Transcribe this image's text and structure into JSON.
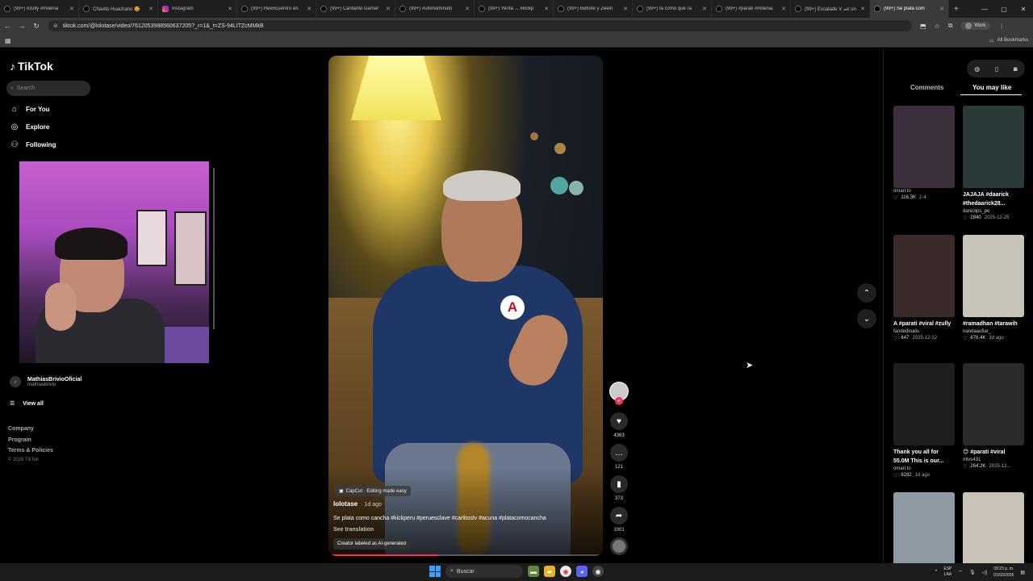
{
  "browser": {
    "tabs": [
      {
        "title": "(99+) #zully #milenia"
      },
      {
        "title": "Chavito Huachano 🤩"
      },
      {
        "title": "Instagram",
        "icon": "instagram-icon"
      },
      {
        "title": "(99+) Reencuentro en"
      },
      {
        "title": "(99+) Cantante Gamer"
      },
      {
        "title": "(99+) #ultimominuto"
      },
      {
        "title": "(99+) Yerita ... #kickp"
      },
      {
        "title": "(99+) Bebote y Zeein"
      },
      {
        "title": "(99+) tá como que ra"
      },
      {
        "title": "(99+) #parati #milenia"
      },
      {
        "title": "(99+) Escalade V 🏎 un"
      },
      {
        "title": "(99+) Se plata com",
        "active": true
      }
    ],
    "new_tab": "+",
    "url": "tiktok.com/@lolotase/video/7612053988560637205?_r=1&_t=ZS-94LITZcMMkB",
    "profile_label": "Work",
    "bookmarks_label": "All Bookmarks"
  },
  "sidebar": {
    "logo": "TikTok",
    "search_placeholder": "Search",
    "nav": [
      {
        "label": "For You",
        "icon": "home-icon"
      },
      {
        "label": "Explore",
        "icon": "compass-icon"
      },
      {
        "label": "Following",
        "icon": "following-icon"
      }
    ],
    "account": {
      "name": "MathiasBrivioOficial",
      "handle": "mathiasbrivio"
    },
    "view_all": "View all",
    "footer": [
      "Company",
      "Program",
      "Terms & Policies"
    ],
    "copyright": "© 2026 TikTok"
  },
  "video": {
    "capcut_label": "CapCut · Editing made easy",
    "author": "lolotase",
    "age": "· 1d ago",
    "caption": "Se plata como cancha #kickperu #peruesclave #carlitostv #acuna #platacomocancha",
    "see_translation": "See translation",
    "ai_label": "Creator labeled as AI-generated",
    "badge_letter": "A",
    "actions": {
      "likes": "4363",
      "comments": "121",
      "saves": "373",
      "shares": "1001"
    },
    "progress": 0.4
  },
  "right_panel": {
    "tabs": [
      "Comments",
      "You may like"
    ],
    "active_tab": "You may like",
    "cards": [
      {
        "title": "",
        "user": "omari.to",
        "likes": "116.3K",
        "date": "2-4",
        "color": "#3a2f3a"
      },
      {
        "title": "JAJAJA #daarick #thedaarick28...",
        "user": "daniclips_pe",
        "likes": "2840",
        "date": "2025-12-25",
        "color": "#2a3a38"
      },
      {
        "title": "A #parati #viral #zully",
        "user": "fandedioalis",
        "likes": "647",
        "date": "2025-12-12",
        "color": "#3b2a2a"
      },
      {
        "title": "#ramadhan #tarawih",
        "user": "nandaaufiar_",
        "likes": "876.4K",
        "date": "3d ago",
        "color": "#c8c4b8"
      },
      {
        "title": "Thank you all for 55.0M This is our...",
        "user": "omari.to",
        "likes": "8282",
        "date": "1d ago",
        "color": "#1e1e1e"
      },
      {
        "title": "😊 #parati #viral",
        "user": "mlvs431",
        "likes": "264.2K",
        "date": "2025-12...",
        "color": "#2a2a2a"
      },
      {
        "title": "",
        "user": "",
        "likes": "",
        "date": "",
        "color": "#8e99a4"
      },
      {
        "title": "",
        "user": "",
        "likes": "",
        "date": "",
        "color": "#c9c2b8"
      }
    ]
  },
  "taskbar": {
    "search_placeholder": "Buscar",
    "lang_top": "ESP",
    "lang_bottom": "LAA",
    "time": "09:23 p. m.",
    "date": "01/03/2026"
  }
}
